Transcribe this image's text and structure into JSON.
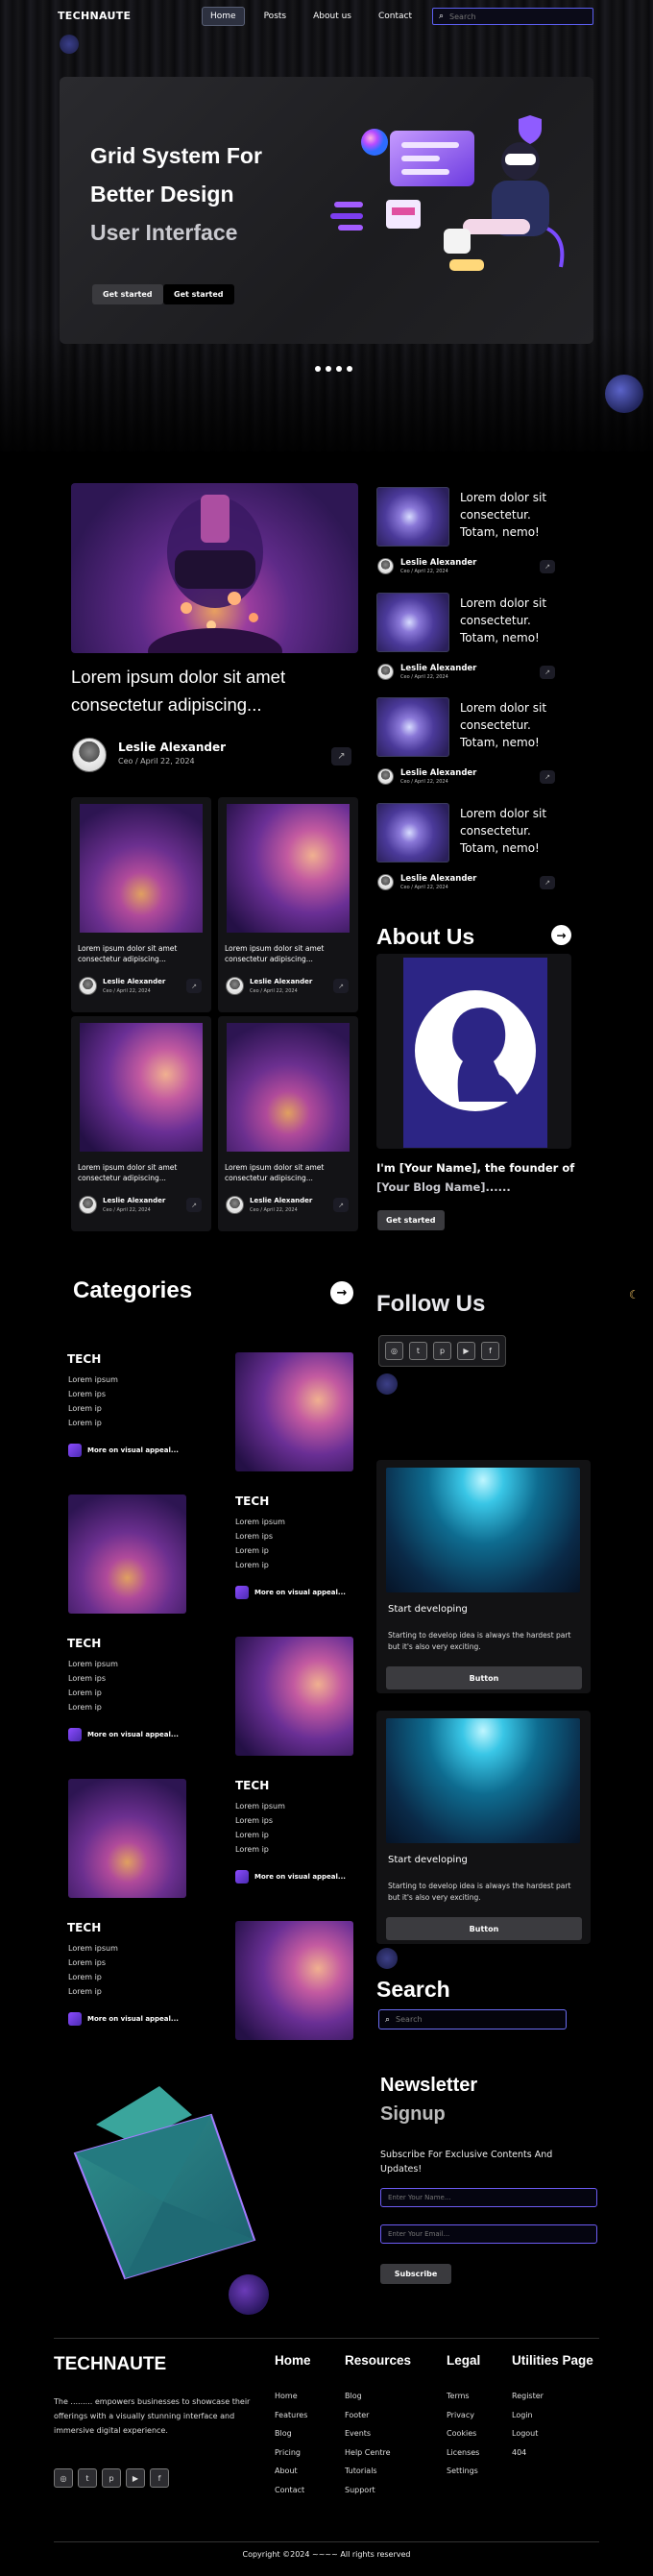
{
  "header": {
    "logo": "TECHNAUTE",
    "nav": [
      "Home",
      "Posts",
      "About us",
      "Contact"
    ],
    "search_placeholder": "Search"
  },
  "hero": {
    "line1": "Grid System For",
    "line2": "Better Design",
    "line3": "User Interface",
    "btn1": "Get started",
    "btn2": "Get started"
  },
  "featured": {
    "title": "Lorem ipsum dolor sit amet consectetur adipiscing...",
    "author": "Leslie Alexander",
    "meta": "Ceo / April 22, 2024"
  },
  "side_posts": [
    {
      "title": "Lorem dolor sit consectetur. Totam, nemo!",
      "author": "Leslie Alexander",
      "meta": "Ceo / April 22, 2024"
    },
    {
      "title": "Lorem dolor sit consectetur. Totam, nemo!",
      "author": "Leslie Alexander",
      "meta": "Ceo / April 22, 2024"
    },
    {
      "title": "Lorem dolor sit consectetur. Totam, nemo!",
      "author": "Leslie Alexander",
      "meta": "Ceo / April 22, 2024"
    },
    {
      "title": "Lorem dolor sit consectetur. Totam, nemo!",
      "author": "Leslie Alexander",
      "meta": "Ceo / April 22, 2024"
    }
  ],
  "grid_posts": [
    {
      "title": "Lorem ipsum dolor sit amet consectetur adipiscing...",
      "author": "Leslie Alexander",
      "meta": "Ceo / April 22, 2024"
    },
    {
      "title": "Lorem ipsum dolor sit amet consectetur adipiscing...",
      "author": "Leslie Alexander",
      "meta": "Ceo / April 22, 2024"
    },
    {
      "title": "Lorem ipsum dolor sit amet consectetur adipiscing...",
      "author": "Leslie Alexander",
      "meta": "Ceo / April 22, 2024"
    },
    {
      "title": "Lorem ipsum dolor sit amet consectetur adipiscing...",
      "author": "Leslie Alexander",
      "meta": "Ceo / April 22, 2024"
    }
  ],
  "about": {
    "heading": "About Us",
    "line1": "I'm [Your Name], the founder of",
    "line2": "[Your Blog Name]......",
    "button": "Get started"
  },
  "categories": {
    "heading": "Categories",
    "items": [
      {
        "title": "TECH",
        "links": [
          "Lorem ipsum",
          "Lorem ips",
          "Lorem ip",
          "Lorem ip"
        ],
        "more": "More on visual appeal..."
      },
      {
        "title": "TECH",
        "links": [
          "Lorem ipsum",
          "Lorem ips",
          "Lorem ip",
          "Lorem ip"
        ],
        "more": "More on visual appeal..."
      },
      {
        "title": "TECH",
        "links": [
          "Lorem ipsum",
          "Lorem ips",
          "Lorem ip",
          "Lorem ip"
        ],
        "more": "More on visual appeal..."
      },
      {
        "title": "TECH",
        "links": [
          "Lorem ipsum",
          "Lorem ips",
          "Lorem ip",
          "Lorem ip"
        ],
        "more": "More on visual appeal..."
      },
      {
        "title": "TECH",
        "links": [
          "Lorem ipsum",
          "Lorem ips",
          "Lorem ip",
          "Lorem ip"
        ],
        "more": "More on visual appeal..."
      }
    ]
  },
  "follow": {
    "heading": "Follow Us",
    "icons": [
      "instagram-icon",
      "twitter-icon",
      "pinterest-icon",
      "youtube-icon",
      "facebook-icon"
    ]
  },
  "dev_cards": [
    {
      "title": "Start developing",
      "desc": "Starting to develop idea is always the hardest part but it's also very exciting.",
      "button": "Button"
    },
    {
      "title": "Start developing",
      "desc": "Starting to develop idea is always the hardest part but it's also very exciting.",
      "button": "Button"
    }
  ],
  "search_side": {
    "heading": "Search",
    "placeholder": "Search"
  },
  "newsletter": {
    "line1": "Newsletter",
    "line2": "Signup",
    "desc": "Subscribe For Exclusive Contents And Updates!",
    "name_placeholder": "Enter Your Name...",
    "email_placeholder": "Enter Your Email...",
    "button": "Subscribe"
  },
  "footer": {
    "logo": "TECHNAUTE",
    "desc": "The ......... empowers businesses to showcase their offerings with a visually stunning interface and immersive digital experience.",
    "columns": [
      {
        "heading": "Home",
        "links": [
          "Home",
          "Features",
          "Blog",
          "Pricing",
          "About",
          "Contact"
        ]
      },
      {
        "heading": "Resources",
        "links": [
          "Blog",
          "Footer",
          "Events",
          "Help Centre",
          "Tutorials",
          "Support"
        ]
      },
      {
        "heading": "Legal",
        "links": [
          "Terms",
          "Privacy",
          "Cookies",
          "Licenses",
          "Settings"
        ]
      },
      {
        "heading": "Utilities Page",
        "links": [
          "Register",
          "Login",
          "Logout",
          "404"
        ]
      }
    ],
    "copyright": "Copyright ©2024 ~~~~ All rights reserved"
  }
}
